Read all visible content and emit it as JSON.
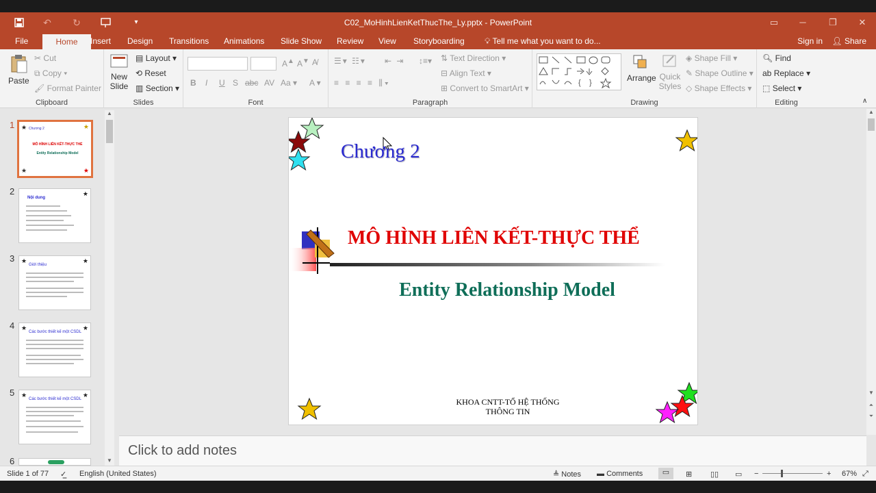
{
  "window": {
    "document_title": "C02_MoHinhLienKetThucThe_Ly.pptx - PowerPoint"
  },
  "tabs": [
    "File",
    "Home",
    "Insert",
    "Design",
    "Transitions",
    "Animations",
    "Slide Show",
    "Review",
    "View",
    "Storyboarding"
  ],
  "active_tab": "Home",
  "tell_me": "Tell me what you want to do...",
  "account": {
    "sign_in": "Sign in",
    "share": "Share"
  },
  "ribbon": {
    "clipboard": {
      "label": "Clipboard",
      "paste": "Paste",
      "cut": "Cut",
      "copy": "Copy",
      "format_painter": "Format Painter"
    },
    "slides": {
      "label": "Slides",
      "new_slide_1": "New",
      "new_slide_2": "Slide",
      "layout": "Layout",
      "reset": "Reset",
      "section": "Section"
    },
    "font": {
      "label": "Font",
      "bold": "B",
      "italic": "I",
      "underline": "U",
      "shadow": "S",
      "strike": "abc",
      "case": "Aa",
      "color": "A"
    },
    "paragraph": {
      "label": "Paragraph",
      "text_direction": "Text Direction",
      "align_text": "Align Text",
      "convert_smartart": "Convert to SmartArt"
    },
    "drawing": {
      "label": "Drawing",
      "arrange": "Arrange",
      "quick_styles_1": "Quick",
      "quick_styles_2": "Styles",
      "shape_fill": "Shape Fill",
      "shape_outline": "Shape Outline",
      "shape_effects": "Shape Effects"
    },
    "editing": {
      "label": "Editing",
      "find": "Find",
      "replace": "Replace",
      "select": "Select"
    }
  },
  "thumbnails": [
    {
      "num": "1",
      "title": "Chương 2"
    },
    {
      "num": "2",
      "title": "Nội dung"
    },
    {
      "num": "3",
      "title": "Giới thiệu"
    },
    {
      "num": "4",
      "title": "Các bước thiết kế một CSDL"
    },
    {
      "num": "5",
      "title": "Các bước thiết kế một CSDL"
    },
    {
      "num": "6",
      "title": ""
    }
  ],
  "slide": {
    "chapter": "Chương 2",
    "title": "MÔ HÌNH LIÊN KẾT-THỰC THỂ",
    "subtitle": "Entity Relationship Model",
    "footer_line1": "KHOA CNTT-TỔ HỆ THỐNG",
    "footer_line2": "THÔNG TIN"
  },
  "notes_placeholder": "Click to add notes",
  "status": {
    "slide_info": "Slide 1 of 77",
    "language": "English (United States)",
    "notes": "Notes",
    "comments": "Comments",
    "zoom": "67%",
    "zoom_level": 0.67
  },
  "colors": {
    "accent": "#b7472a",
    "selected_thumb": "#e0733f",
    "chapter_text": "#2a2ad0",
    "title_text": "#e00000",
    "subtitle_text": "#0f6e58"
  }
}
